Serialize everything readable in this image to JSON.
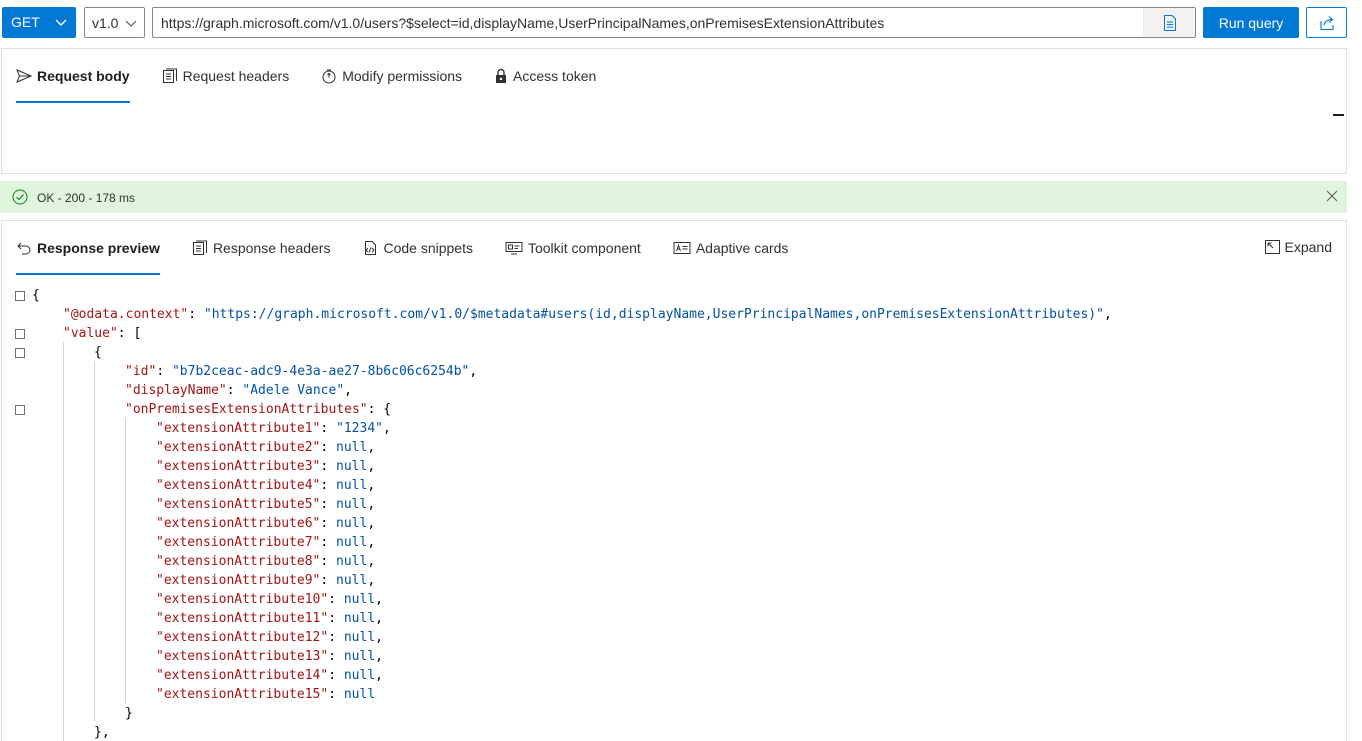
{
  "toolbar": {
    "method": "GET",
    "version": "v1.0",
    "url": "https://graph.microsoft.com/v1.0/users?$select=id,displayName,UserPrincipalNames,onPremisesExtensionAttributes",
    "run_label": "Run query"
  },
  "request_tabs": [
    {
      "label": "Request body",
      "icon": "send-icon",
      "active": true
    },
    {
      "label": "Request headers",
      "icon": "headers-icon",
      "active": false
    },
    {
      "label": "Modify permissions",
      "icon": "shield-icon",
      "active": false
    },
    {
      "label": "Access token",
      "icon": "lock-icon",
      "active": false
    }
  ],
  "status": {
    "text": "OK - 200 - 178 ms",
    "color": "#dff6dd"
  },
  "response_tabs": [
    {
      "label": "Response preview",
      "icon": "undo-arrow-icon",
      "active": true
    },
    {
      "label": "Response headers",
      "icon": "headers-icon",
      "active": false
    },
    {
      "label": "Code snippets",
      "icon": "code-icon",
      "active": false
    },
    {
      "label": "Toolkit component",
      "icon": "toolkit-icon",
      "active": false
    },
    {
      "label": "Adaptive cards",
      "icon": "card-icon",
      "active": false
    }
  ],
  "expand_label": "Expand",
  "json": {
    "open_brace": "{",
    "context_key": "\"@odata.context\"",
    "context_value": "\"https://graph.microsoft.com/v1.0/$metadata#users(id,displayName,UserPrincipalNames,onPremisesExtensionAttributes)\"",
    "value_key": "\"value\"",
    "item_open": "{",
    "id_key": "\"id\"",
    "id_value": "\"b7b2ceac-adc9-4e3a-ae27-8b6c06c6254b\"",
    "displayName_key": "\"displayName\"",
    "displayName_value": "\"Adele Vance\"",
    "ext_key": "\"onPremisesExtensionAttributes\"",
    "attributes": [
      {
        "key": "\"extensionAttribute1\"",
        "value": "\"1234\"",
        "is_string": true
      },
      {
        "key": "\"extensionAttribute2\"",
        "value": "null",
        "is_string": false
      },
      {
        "key": "\"extensionAttribute3\"",
        "value": "null",
        "is_string": false
      },
      {
        "key": "\"extensionAttribute4\"",
        "value": "null",
        "is_string": false
      },
      {
        "key": "\"extensionAttribute5\"",
        "value": "null",
        "is_string": false
      },
      {
        "key": "\"extensionAttribute6\"",
        "value": "null",
        "is_string": false
      },
      {
        "key": "\"extensionAttribute7\"",
        "value": "null",
        "is_string": false
      },
      {
        "key": "\"extensionAttribute8\"",
        "value": "null",
        "is_string": false
      },
      {
        "key": "\"extensionAttribute9\"",
        "value": "null",
        "is_string": false
      },
      {
        "key": "\"extensionAttribute10\"",
        "value": "null",
        "is_string": false
      },
      {
        "key": "\"extensionAttribute11\"",
        "value": "null",
        "is_string": false
      },
      {
        "key": "\"extensionAttribute12\"",
        "value": "null",
        "is_string": false
      },
      {
        "key": "\"extensionAttribute13\"",
        "value": "null",
        "is_string": false
      },
      {
        "key": "\"extensionAttribute14\"",
        "value": "null",
        "is_string": false
      },
      {
        "key": "\"extensionAttribute15\"",
        "value": "null",
        "is_string": false
      }
    ],
    "ext_close": "}",
    "item_close": "},"
  },
  "colors": {
    "accent": "#0078d4",
    "json_key": "#a31515",
    "json_value": "#0451a5",
    "status_bg": "#dff6dd"
  }
}
